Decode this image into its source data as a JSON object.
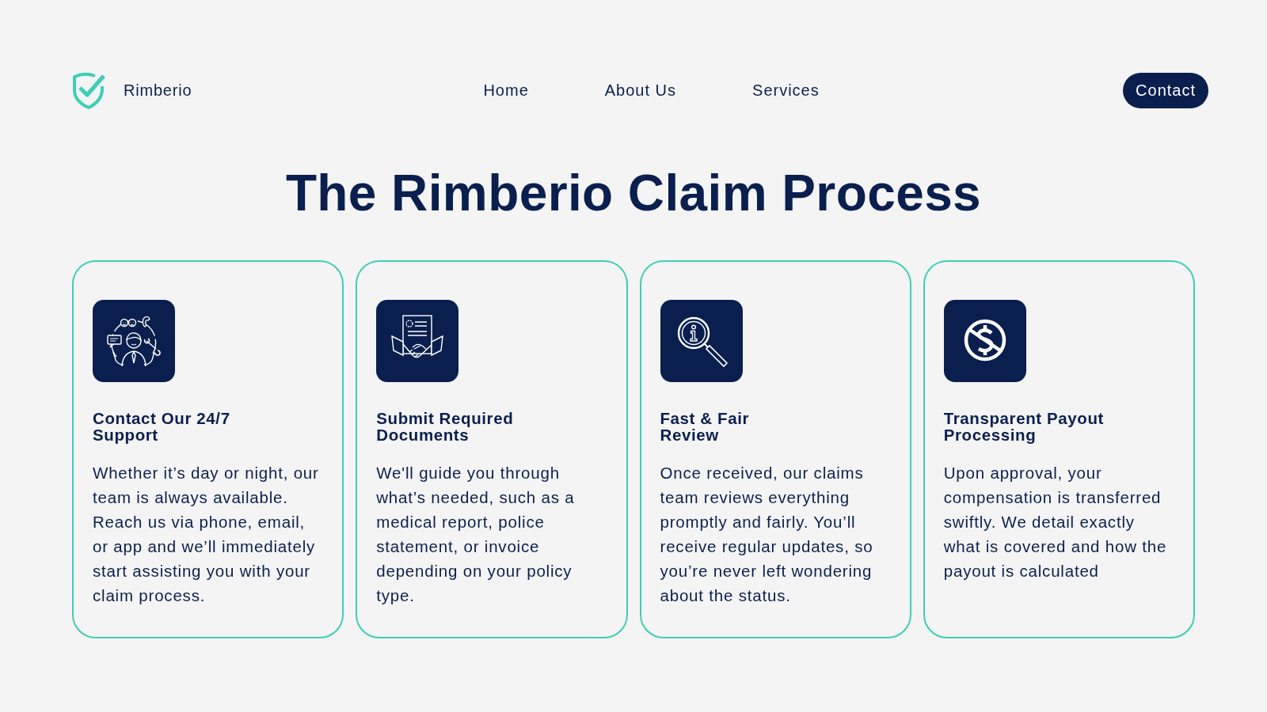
{
  "brand": {
    "name": "Rimberio"
  },
  "nav": {
    "links": [
      "Home",
      "About Us",
      "Services"
    ],
    "cta": "Contact"
  },
  "heading": "The Rimberio Claim Process",
  "steps": [
    {
      "title": "Contact Our 24/7\nSupport",
      "body": "Whether it’s day or night, our team is always available. Reach us via phone, email, or app and we’ll immediately start assisting you with your claim process."
    },
    {
      "title": "Submit Required\nDocuments",
      "body": "We'll guide you through what’s needed, such as a medical report, police statement, or invoice depending on your policy type."
    },
    {
      "title": "Fast & Fair\nReview",
      "body": "Once received, our claims team reviews everything promptly and fairly. You’ll receive regular updates, so you’re never left wondering about the status."
    },
    {
      "title": "Transparent Payout\nProcessing",
      "body": "Upon approval, your compensation is transferred swiftly. We detail exactly what is covered and how the payout is calculated"
    }
  ]
}
